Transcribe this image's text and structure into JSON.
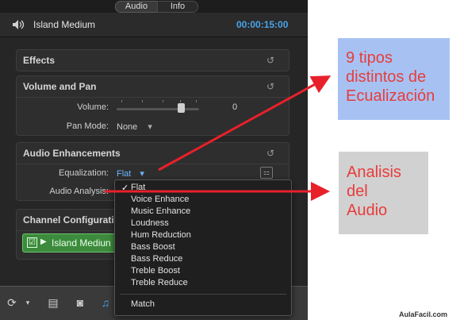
{
  "tabs": {
    "audio": "Audio",
    "info": "Info"
  },
  "header": {
    "clip_title": "Island Medium",
    "timecode": "00:00:15:00"
  },
  "effects": {
    "title": "Effects",
    "reset": "↺"
  },
  "volume_pan": {
    "title": "Volume and Pan",
    "reset": "↺",
    "volume_label": "Volume:",
    "volume_value": "0",
    "pan_mode_label": "Pan Mode:",
    "pan_mode_value": "None",
    "pan_chevron": "▾"
  },
  "audio_enhancements": {
    "title": "Audio Enhancements",
    "reset": "↺",
    "equalization_label": "Equalization:",
    "equalization_value": "Flat",
    "eq_chevron": "▾",
    "audio_analysis_label": "Audio Analysis:"
  },
  "channel": {
    "title": "Channel Configuratio",
    "clip_chip_label": "Island Mediun",
    "chip_check": "☑",
    "chip_arrow": "▶"
  },
  "eq_menu": {
    "checked": "✓",
    "items": [
      "Flat",
      "Voice Enhance",
      "Music Enhance",
      "Loudness",
      "Hum Reduction",
      "Bass Boost",
      "Bass Reduce",
      "Treble Boost",
      "Treble Reduce"
    ],
    "footer_item": "Match"
  },
  "annotations": {
    "note1": [
      "9 tipos",
      "distintos de",
      "Ecualización"
    ],
    "note2": [
      "Analisis",
      "del",
      "Audio"
    ]
  },
  "watermark": "AulaFacil.com",
  "colors": {
    "accent_blue": "#4aa3e8",
    "annotation_red": "#e83c3c",
    "chip_green": "#3c8a3c"
  }
}
